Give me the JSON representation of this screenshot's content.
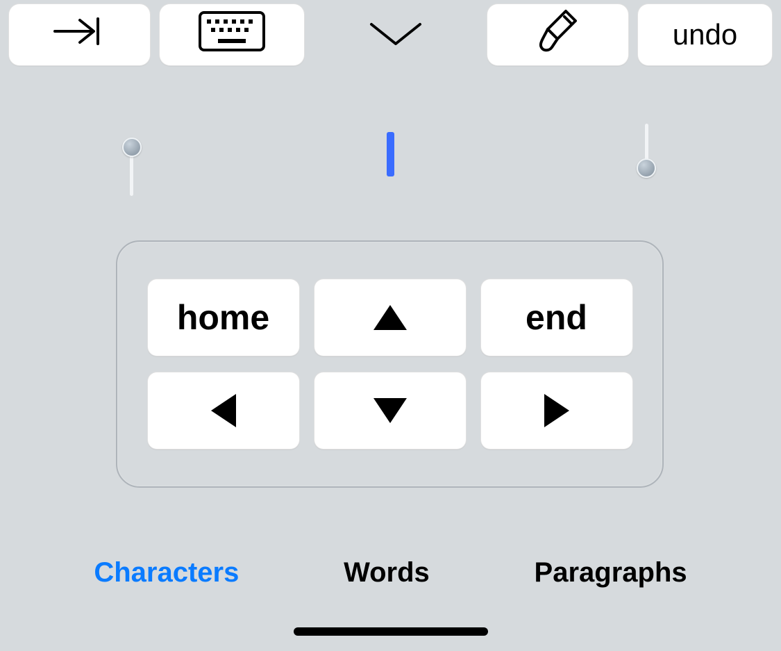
{
  "toolbar": {
    "tab_label": "tab",
    "keyboard_label": "keyboard",
    "expand_label": "expand",
    "format_label": "format",
    "undo_label": "undo"
  },
  "navpad": {
    "home_label": "home",
    "end_label": "end",
    "up_label": "up",
    "down_label": "down",
    "left_label": "left",
    "right_label": "right"
  },
  "segmented": {
    "tabs": [
      {
        "label": "Characters",
        "active": true
      },
      {
        "label": "Words",
        "active": false
      },
      {
        "label": "Paragraphs",
        "active": false
      }
    ]
  },
  "colors": {
    "accent": "#0a7bff",
    "caret": "#3a6cff",
    "background": "#d6dadd"
  }
}
